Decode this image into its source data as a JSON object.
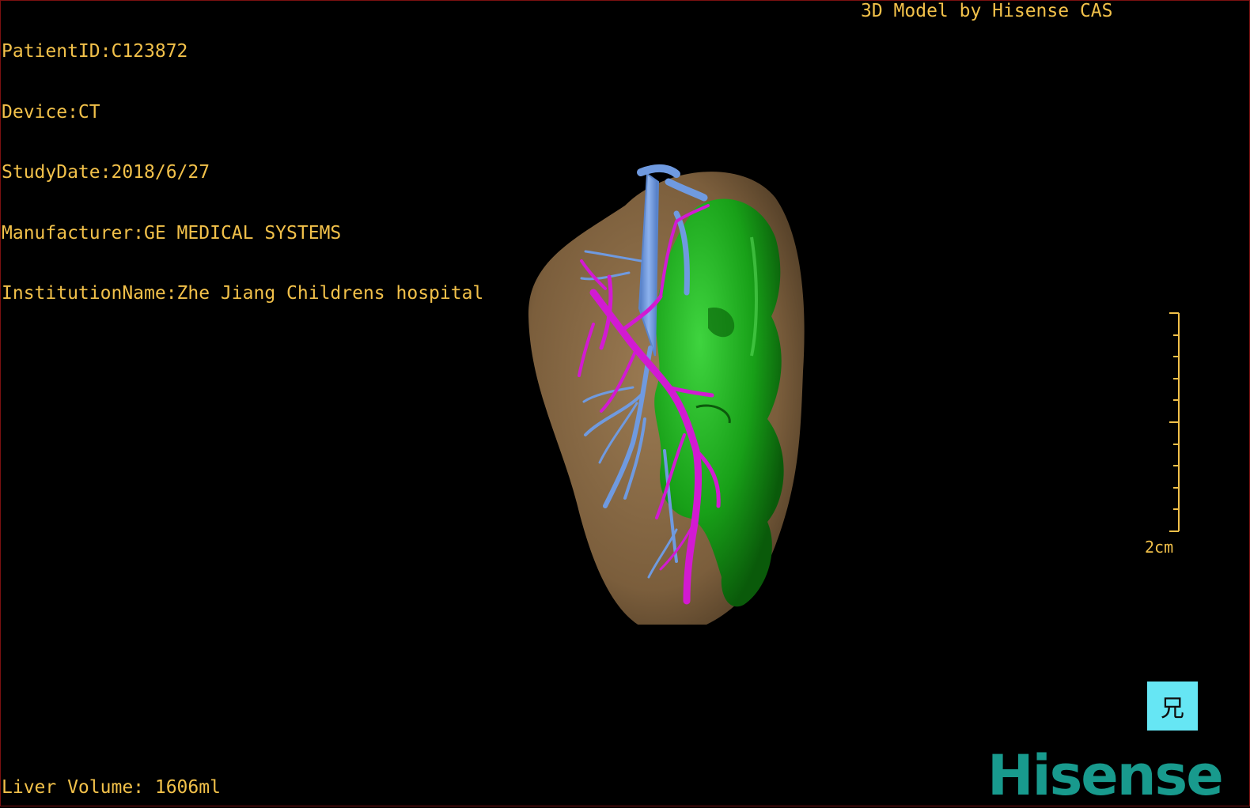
{
  "header_info": {
    "patient_id": "PatientID:C123872",
    "device": "Device:CT",
    "study_date": "StudyDate:2018/6/27",
    "manufacturer": "Manufacturer:GE MEDICAL SYSTEMS",
    "institution": "InstitutionName:Zhe Jiang Childrens hospital"
  },
  "credit": "3D Model by Hisense CAS",
  "liver_volume": "Liver Volume: 1606ml",
  "scale": {
    "label": "2cm"
  },
  "orientation_cube": {
    "glyph": "兄",
    "color": "#66e6f4"
  },
  "brand_logo": "Hisense",
  "colors": {
    "overlay_text": "#f2c14a",
    "liver": "#8a6a45",
    "tumor": "#1aa81a",
    "portal_vein": "#d21ad2",
    "hepatic_vein": "#6f9ae0",
    "logo": "#189a8d"
  }
}
